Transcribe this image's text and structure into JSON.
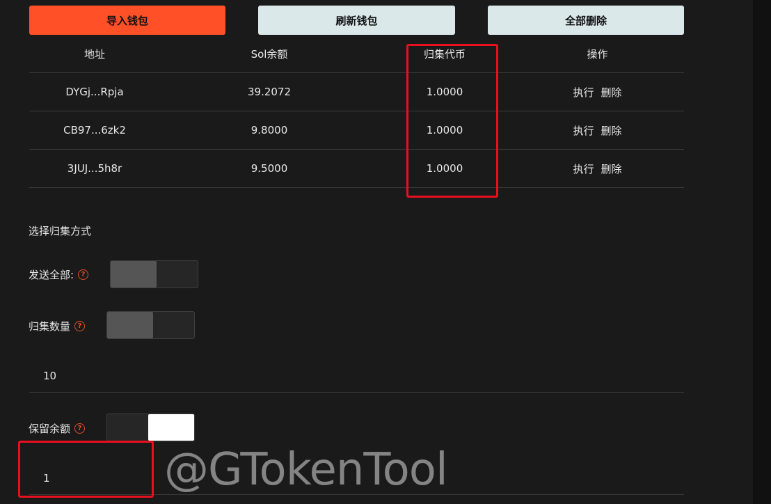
{
  "toolbar": {
    "import_label": "导入钱包",
    "refresh_label": "刷新钱包",
    "delete_all_label": "全部删除"
  },
  "table": {
    "headers": [
      "地址",
      "Sol余额",
      "归集代币",
      "操作"
    ],
    "rows": [
      {
        "address": "DYGj...Rpja",
        "sol": "39.2072",
        "token": "1.0000",
        "exec": "执行",
        "del": "删除"
      },
      {
        "address": "CB97...6zk2",
        "sol": "9.8000",
        "token": "1.0000",
        "exec": "执行",
        "del": "删除"
      },
      {
        "address": "3JUJ...5h8r",
        "sol": "9.5000",
        "token": "1.0000",
        "exec": "执行",
        "del": "删除"
      }
    ]
  },
  "form": {
    "section_title": "选择归集方式",
    "send_all_label": "发送全部:",
    "send_all_on": false,
    "collect_amount_label": "归集数量",
    "collect_amount_on": false,
    "collect_amount_value": "10",
    "reserve_label": "保留余额",
    "reserve_on": true,
    "reserve_value": "1"
  },
  "watermark": "@GTokenTool",
  "colors": {
    "accent": "#ff5028",
    "secondary_button": "#dbe8ea",
    "highlight_box": "#e8101e",
    "help_icon": "#e0502a"
  }
}
